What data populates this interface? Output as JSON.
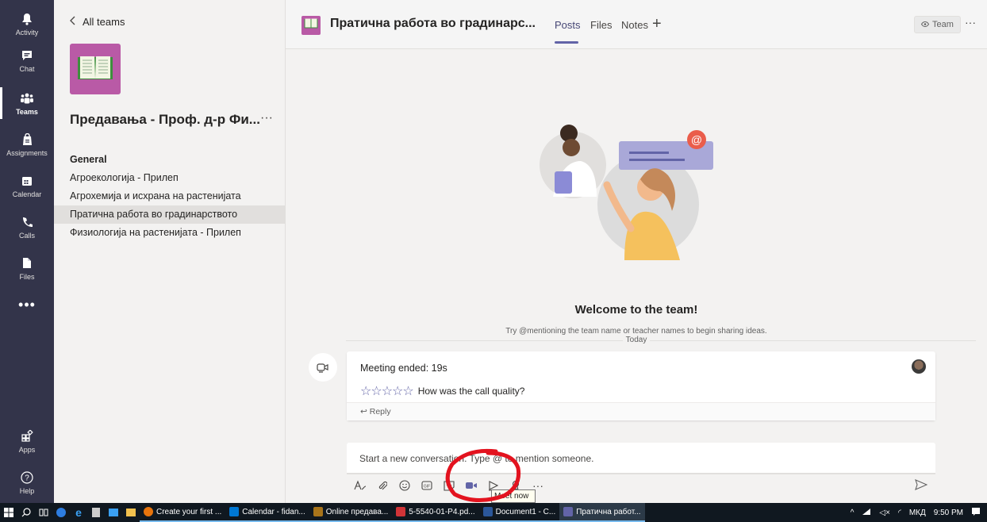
{
  "rail": {
    "items": [
      {
        "label": "Activity",
        "icon": "bell-icon"
      },
      {
        "label": "Chat",
        "icon": "chat-icon"
      },
      {
        "label": "Teams",
        "icon": "teams-icon",
        "active": true
      },
      {
        "label": "Assignments",
        "icon": "assignments-icon"
      },
      {
        "label": "Calendar",
        "icon": "calendar-icon"
      },
      {
        "label": "Calls",
        "icon": "phone-icon"
      },
      {
        "label": "Files",
        "icon": "file-icon"
      }
    ],
    "more": "•••",
    "apps": "Apps",
    "help": "Help"
  },
  "panel": {
    "back_label": "All teams",
    "team_name": "Предавања - Проф. д-р Фи...",
    "team_more": "···",
    "channels": [
      "General",
      "Агроекологија - Прилеп",
      "Агрохемија и исхрана на растенијата",
      "Пратична работа во градинарството",
      "Физиологија на растенијата - Прилеп"
    ]
  },
  "header": {
    "title": "Пратична работа во градинарс...",
    "tabs": [
      "Posts",
      "Files",
      "Notes"
    ],
    "add_tab": "+",
    "team_button": "Team",
    "more": "···"
  },
  "welcome": {
    "title": "Welcome to the team!",
    "subtitle": "Try @mentioning the team name or teacher names to begin sharing ideas.",
    "today": "Today"
  },
  "meeting_card": {
    "title": "Meeting ended: 19s",
    "rating_prompt": "How was the call quality?",
    "stars": "☆☆☆☆☆",
    "reply": "Reply"
  },
  "compose": {
    "placeholder": "Start a new conversation. Type @ to mention someone.",
    "tooltip": "Meet now",
    "more": "···"
  },
  "taskbar": {
    "tasks": [
      {
        "label": "Create your first ...",
        "color": "#e8740c"
      },
      {
        "label": "Calendar - fidan...",
        "color": "#0078d4"
      },
      {
        "label": "Online предава...",
        "color": "#a8741a"
      },
      {
        "label": "5-5540-01-P4.pd...",
        "color": "#d13438"
      },
      {
        "label": "Document1 - C...",
        "color": "#2b579a"
      },
      {
        "label": "Пратична работ...",
        "color": "#6264a7"
      }
    ],
    "language": "МКД",
    "time": "9:50 PM"
  },
  "colors": {
    "rail": "#33344a",
    "accent": "#6264a7",
    "team_avatar": "#b95aa6",
    "annotation": "#e3131f"
  }
}
